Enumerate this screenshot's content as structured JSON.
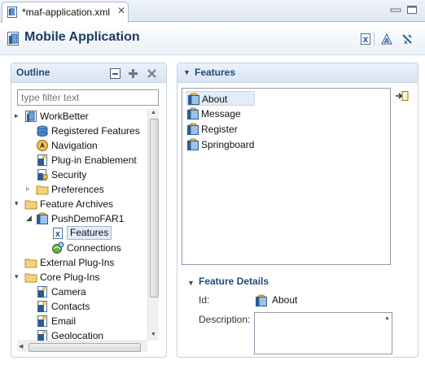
{
  "tab": {
    "label": "*maf-application.xml",
    "close": "✕"
  },
  "editor": {
    "title": "Mobile Application"
  },
  "outline": {
    "title": "Outline",
    "filter_placeholder": "type filter text",
    "tree": [
      {
        "label": "WorkBetter",
        "icon": "app-icon",
        "twisty": "▸",
        "level": 0
      },
      {
        "label": "Registered Features",
        "icon": "features-icon",
        "twisty": "",
        "level": 1
      },
      {
        "label": "Navigation",
        "icon": "navigation-icon",
        "twisty": "",
        "level": 1
      },
      {
        "label": "Plug-in Enablement",
        "icon": "plugin-icon",
        "twisty": "",
        "level": 1
      },
      {
        "label": "Security",
        "icon": "security-icon",
        "twisty": "",
        "level": 1
      },
      {
        "label": "Preferences",
        "icon": "folder-icon",
        "twisty": "▹",
        "level": 1
      },
      {
        "label": "Feature Archives",
        "icon": "folder-icon",
        "twisty": "▾",
        "level": 0
      },
      {
        "label": "PushDemoFAR1",
        "icon": "archive-icon",
        "twisty": "◢",
        "level": 1
      },
      {
        "label": "Features",
        "icon": "features-xml-icon",
        "twisty": "",
        "level": 2,
        "selected": true
      },
      {
        "label": "Connections",
        "icon": "connections-icon",
        "twisty": "",
        "level": 2
      },
      {
        "label": "External Plug-Ins",
        "icon": "folder-icon",
        "twisty": "",
        "level": 0
      },
      {
        "label": "Core Plug-Ins",
        "icon": "folder-icon",
        "twisty": "▾",
        "level": 0
      },
      {
        "label": "Camera",
        "icon": "plugin-icon",
        "twisty": "",
        "level": 1
      },
      {
        "label": "Contacts",
        "icon": "plugin-icon",
        "twisty": "",
        "level": 1
      },
      {
        "label": "Email",
        "icon": "plugin-icon",
        "twisty": "",
        "level": 1
      },
      {
        "label": "Geolocation",
        "icon": "plugin-icon",
        "twisty": "",
        "level": 1
      }
    ]
  },
  "features": {
    "title": "Features",
    "items": [
      {
        "label": "About",
        "icon": "feature-icon",
        "selected": true
      },
      {
        "label": "Message",
        "icon": "feature-icon"
      },
      {
        "label": "Register",
        "icon": "feature-icon"
      },
      {
        "label": "Springboard",
        "icon": "feature-icon"
      }
    ]
  },
  "details": {
    "title": "Feature Details",
    "id_label": "Id:",
    "id_value": "About",
    "description_label": "Description:"
  },
  "colors": {
    "accent": "#1f4a78",
    "title": "#1c3c66",
    "selection": "#e3ecf8"
  }
}
